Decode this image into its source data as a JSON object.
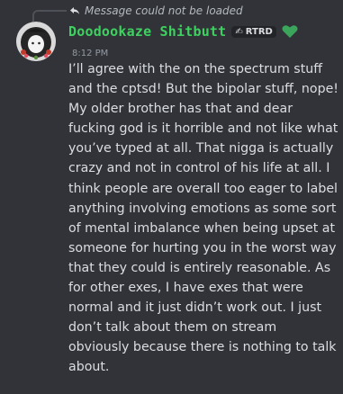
{
  "reply": {
    "icon": "reply-arrow-icon",
    "text": "Message could not be loaded"
  },
  "author": {
    "name": "Doodookaze Shitbutt",
    "name_color": "#3ed160",
    "avatar_icon": "avatar-image",
    "tag": {
      "glyph": "✍",
      "label": "RTRD"
    },
    "badge_icon": "green-heart-icon",
    "badge_color": "#3ba55c"
  },
  "timestamp": "8:12 PM",
  "message": {
    "lines": [
      "I’ll agree with the on the spectrum stuff",
      "and the cptsd! But the bipolar stuff, nope!",
      "My older brother has that and dear",
      "fucking god is it horrible and not like what",
      "you’ve typed at all. That nigga is actually",
      "crazy and not in control of his life at all. I",
      "think people are overall too eager to label",
      "anything involving emotions as some sort",
      "of mental imbalance when being upset at",
      "someone for hurting you in the worst way",
      "that they could is entirely reasonable. As",
      "for other exes, I have exes that were",
      "normal and it just didn’t work out. I just",
      "don’t talk about them on stream",
      "obviously because there is nothing to talk",
      "about."
    ]
  }
}
